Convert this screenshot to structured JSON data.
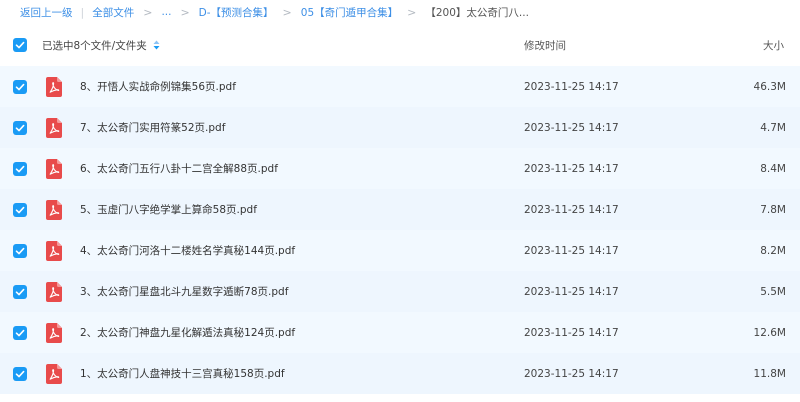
{
  "breadcrumb": {
    "back": "返回上一级",
    "all_files": "全部文件",
    "ellipsis": "...",
    "level1": "D-【预测合集】",
    "level2": "05【奇门遁甲合集】",
    "current": "【200】太公奇门八..."
  },
  "header": {
    "selection": "已选中8个文件/文件夹",
    "mtime": "修改时间",
    "size": "大小"
  },
  "files": [
    {
      "name": "8、开悟人实战命例锦集56页.pdf",
      "mtime": "2023-11-25 14:17",
      "size": "46.3M"
    },
    {
      "name": "7、太公奇门实用符篆52页.pdf",
      "mtime": "2023-11-25 14:17",
      "size": "4.7M"
    },
    {
      "name": "6、太公奇门五行八卦十二宫全解88页.pdf",
      "mtime": "2023-11-25 14:17",
      "size": "8.4M"
    },
    {
      "name": "5、玉虚门八字绝学掌上算命58页.pdf",
      "mtime": "2023-11-25 14:17",
      "size": "7.8M"
    },
    {
      "name": "4、太公奇门河洛十二楼姓名学真秘144页.pdf",
      "mtime": "2023-11-25 14:17",
      "size": "8.2M"
    },
    {
      "name": "3、太公奇门星盘北斗九星数字遁断78页.pdf",
      "mtime": "2023-11-25 14:17",
      "size": "5.5M"
    },
    {
      "name": "2、太公奇门神盘九星化解遁法真秘124页.pdf",
      "mtime": "2023-11-25 14:17",
      "size": "12.6M"
    },
    {
      "name": "1、太公奇门人盘神技十三宫真秘158页.pdf",
      "mtime": "2023-11-25 14:17",
      "size": "11.8M"
    }
  ],
  "icons": {
    "checkbox": "checkbox-checked-icon",
    "file": "pdf-file-icon",
    "sort": "sort-arrow-icon"
  },
  "colors": {
    "accent": "#1a9bf5",
    "link": "#3d8fe6",
    "row_bg": "#f2f9ff",
    "pdf_red": "#e84b4b"
  }
}
